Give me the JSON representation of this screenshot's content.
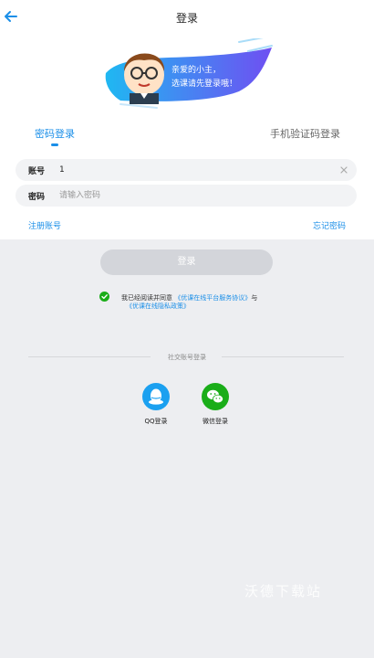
{
  "header": {
    "title": "登录",
    "back_icon": "arrow-left-icon"
  },
  "banner": {
    "line1": "亲爱的小主，",
    "line2": "选课请先登录哦！",
    "colors": {
      "start": "#1fb8f2",
      "end": "#6f4ff2"
    }
  },
  "tabs": [
    {
      "label": "密码登录",
      "active": true
    },
    {
      "label": "手机验证码登录",
      "active": false
    }
  ],
  "form": {
    "account": {
      "label": "账号",
      "value": "1"
    },
    "password": {
      "label": "密码",
      "placeholder": "请输入密码"
    }
  },
  "links": {
    "register": "注册账号",
    "forgot": "忘记密码"
  },
  "login_button": "登录",
  "agreement": {
    "prefix": "我已经阅读并同意",
    "service": "《优课在线平台服务协议》",
    "and": "与",
    "privacy": "《优课在线隐私政策》"
  },
  "social": {
    "label": "社交账号登录",
    "items": [
      {
        "label": "QQ登录",
        "icon": "qq-icon"
      },
      {
        "label": "微信登录",
        "icon": "wechat-icon"
      }
    ]
  },
  "watermark": "沃德下载站",
  "colors": {
    "accent": "#1b8fe8",
    "check": "#1aad19",
    "button_disabled": "#d3d5da"
  }
}
